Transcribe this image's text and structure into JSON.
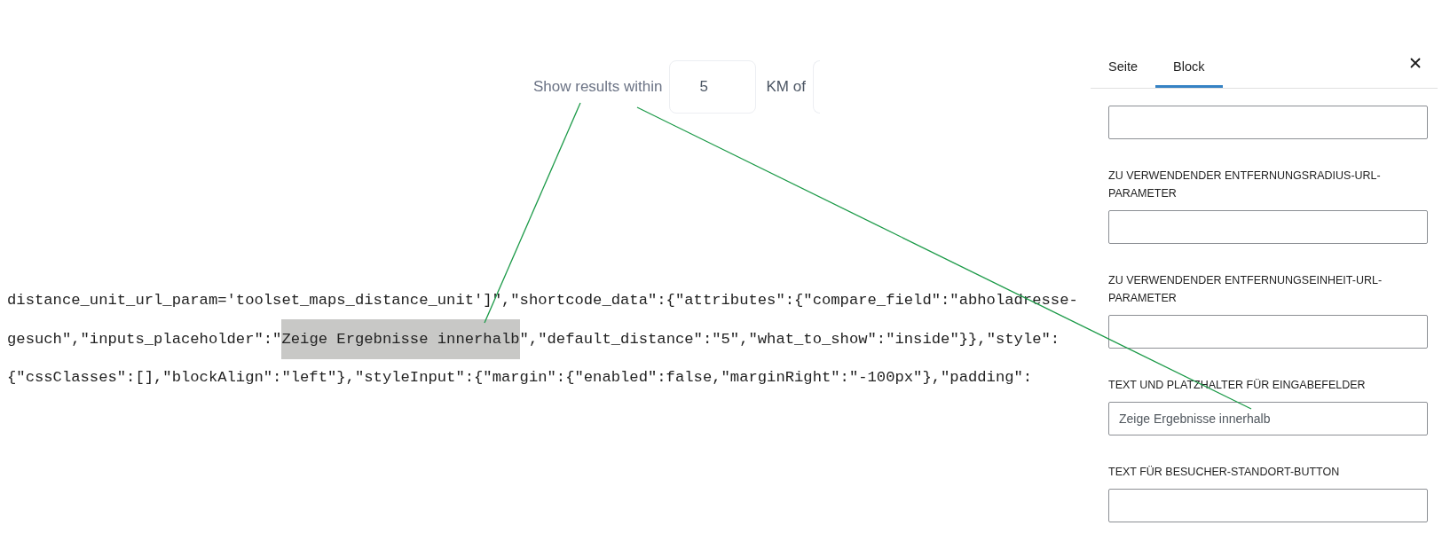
{
  "search_form": {
    "label": "Show results within",
    "distance_field": {
      "value": "5"
    },
    "unit_label": "KM of"
  },
  "code_lines": [
    {
      "segments": [
        {
          "text": "distance_unit_url_param='toolset_maps_distance_unit']\",\"shortcode_data\":{\"attributes\":{\"compare_field\":\"abholadresse-",
          "selected": false
        }
      ]
    },
    {
      "segments": [
        {
          "text": "gesuch\",\"inputs_placeholder\":\"",
          "selected": false
        },
        {
          "text": "Zeige Ergebnisse innerhalb",
          "selected": true
        },
        {
          "text": "\",\"default_distance\":\"5\",\"what_to_show\":\"inside\"}},\"style\":",
          "selected": false
        }
      ]
    },
    {
      "segments": [
        {
          "text": "{\"cssClasses\":[],\"blockAlign\":\"left\"},\"styleInput\":{\"margin\":{\"enabled\":false,\"marginRight\":\"-100px\"},\"padding\":",
          "selected": false
        }
      ]
    }
  ],
  "sidebar": {
    "tabs": [
      {
        "label": "Seite",
        "selected": false
      },
      {
        "label": "Block",
        "selected": true
      }
    ],
    "fields": [
      {
        "kind": "unlabeled"
      },
      {
        "kind": "labeled",
        "label": "ZU VERWENDENDER ENTFERNUNGSRADIUS-URL-PARAMETER"
      },
      {
        "kind": "labeled",
        "label": "ZU VERWENDENDER ENTFERNUNGSEINHEIT-URL-PARAMETER"
      },
      {
        "kind": "labeled",
        "label": "TEXT UND PLATZHALTER FÜR EINGABEFELDER",
        "value": "Zeige Ergebnisse innerhalb"
      },
      {
        "kind": "labeled",
        "label": "TEXT FÜR BESUCHER-STANDORT-BUTTON"
      }
    ]
  }
}
